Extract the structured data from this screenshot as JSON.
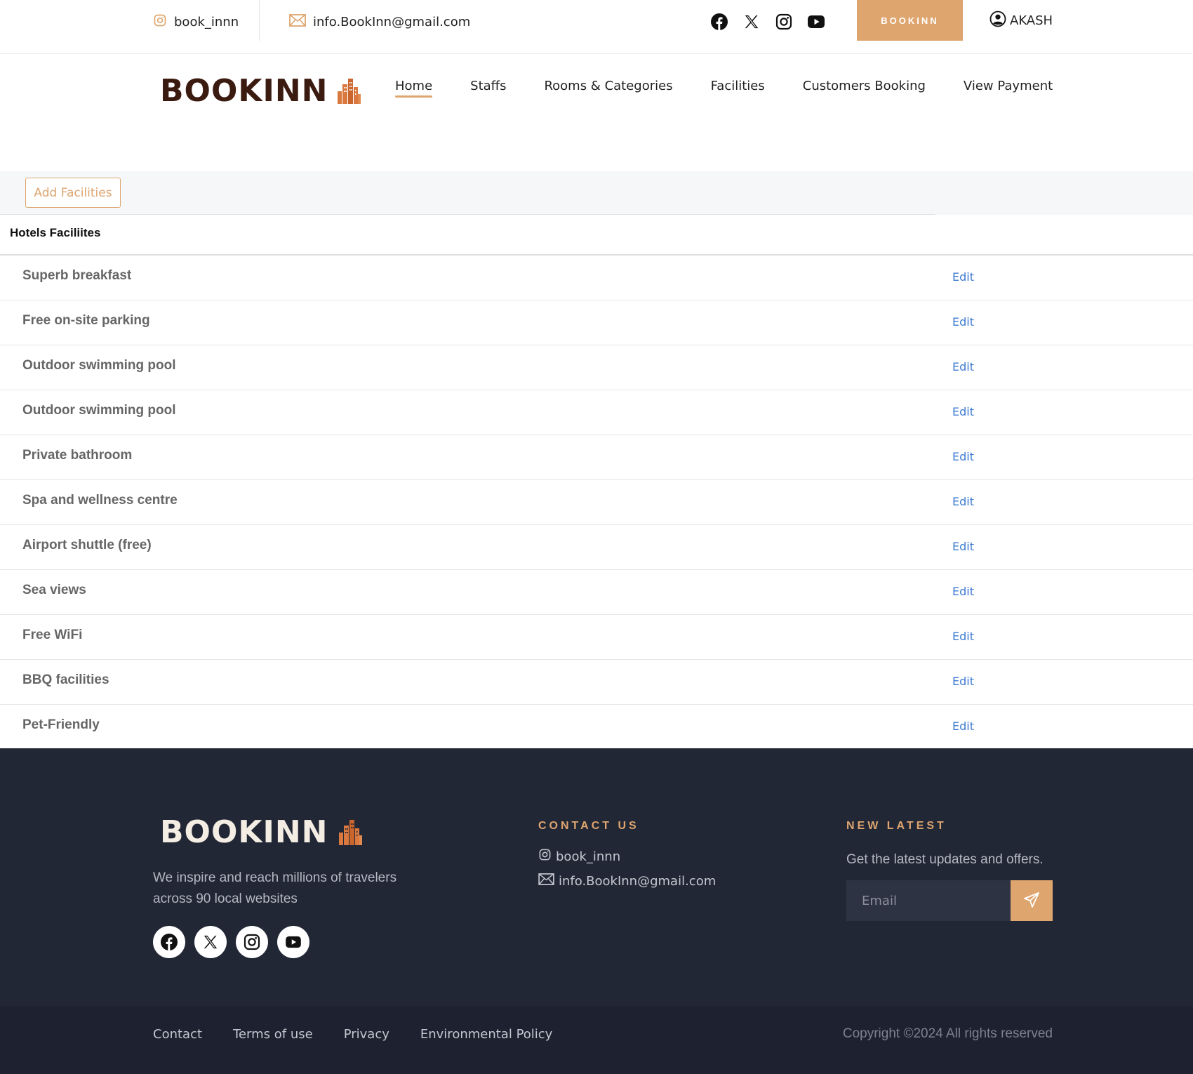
{
  "topbar": {
    "instagram_handle": "book_innn",
    "email": "info.BookInn@gmail.com",
    "social_icons": [
      "facebook-icon",
      "x-icon",
      "instagram-icon",
      "youtube-icon"
    ],
    "book_button": "BOOKINN",
    "user_name": "AKASH"
  },
  "header": {
    "logo_text": "BOOKINN",
    "nav": [
      "Home",
      "Staffs",
      "Rooms & Categories",
      "Facilities",
      "Customers Booking",
      "View Payment"
    ],
    "active_nav": "Home"
  },
  "content": {
    "add_button": "Add Facilities",
    "section_title": "Hotels Faciliites",
    "edit_label": "Edit",
    "facilities": [
      "Superb breakfast",
      "Free on-site parking",
      "Outdoor swimming pool",
      "Outdoor swimming pool",
      "Private bathroom",
      "Spa and wellness centre",
      "Airport shuttle (free)",
      "Sea views",
      "Free WiFi",
      "BBQ facilities",
      "Pet-Friendly"
    ]
  },
  "footer": {
    "logo_text": "BOOKINN",
    "description": "We inspire and reach millions of travelers across 90 local websites",
    "contact_heading": "CONTACT US",
    "contact_instagram": "book_innn",
    "contact_email": "info.BookInn@gmail.com",
    "latest_heading": "NEW LATEST",
    "latest_text": "Get the latest updates and offers.",
    "email_placeholder": "Email",
    "links": [
      "Contact",
      "Terms of use",
      "Privacy",
      "Environmental Policy"
    ],
    "copyright": "Copyright ©2024 All rights reserved"
  },
  "colors": {
    "accent": "#dea56f",
    "logo_dark": "#3b1a10",
    "footer_bg": "#222736",
    "edit_link": "#3d7bd1"
  }
}
